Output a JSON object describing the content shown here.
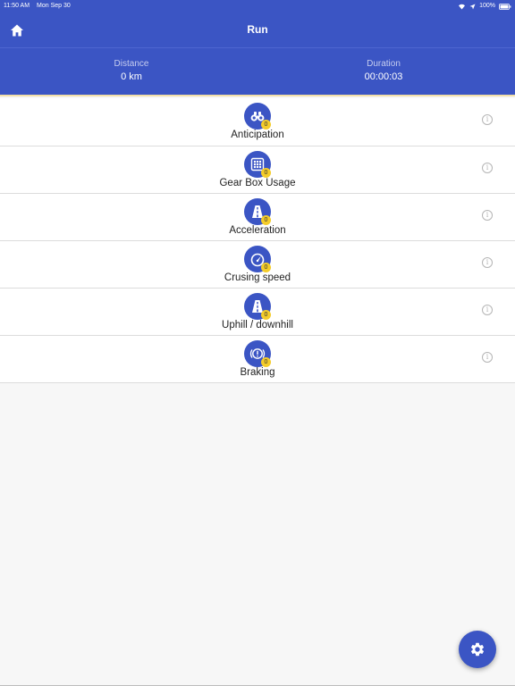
{
  "status_bar": {
    "time": "11:50 AM",
    "date": "Mon Sep 30",
    "battery": "100%",
    "icons": [
      "wifi-icon",
      "location-icon",
      "battery-icon"
    ]
  },
  "nav": {
    "title": "Run",
    "home_icon": "home-icon"
  },
  "stats": {
    "distance_label": "Distance",
    "distance_value": "0 km",
    "duration_label": "Duration",
    "duration_value": "00:00:03"
  },
  "categories": [
    {
      "label": "Anticipation",
      "icon": "binoculars-icon",
      "badge": "0"
    },
    {
      "label": "Gear Box Usage",
      "icon": "gearbox-icon",
      "badge": "0"
    },
    {
      "label": "Acceleration",
      "icon": "road-icon",
      "badge": "0"
    },
    {
      "label": "Crusing speed",
      "icon": "speedometer-icon",
      "badge": "0"
    },
    {
      "label": "Uphill / downhill",
      "icon": "road-icon",
      "badge": "0"
    },
    {
      "label": "Braking",
      "icon": "brake-warning-icon",
      "badge": "0"
    }
  ],
  "info_glyph": "i",
  "fab": {
    "icon": "gear-icon"
  },
  "colors": {
    "primary": "#3b55c4",
    "badge": "#f4cc2a",
    "background": "#f7f7f7"
  }
}
